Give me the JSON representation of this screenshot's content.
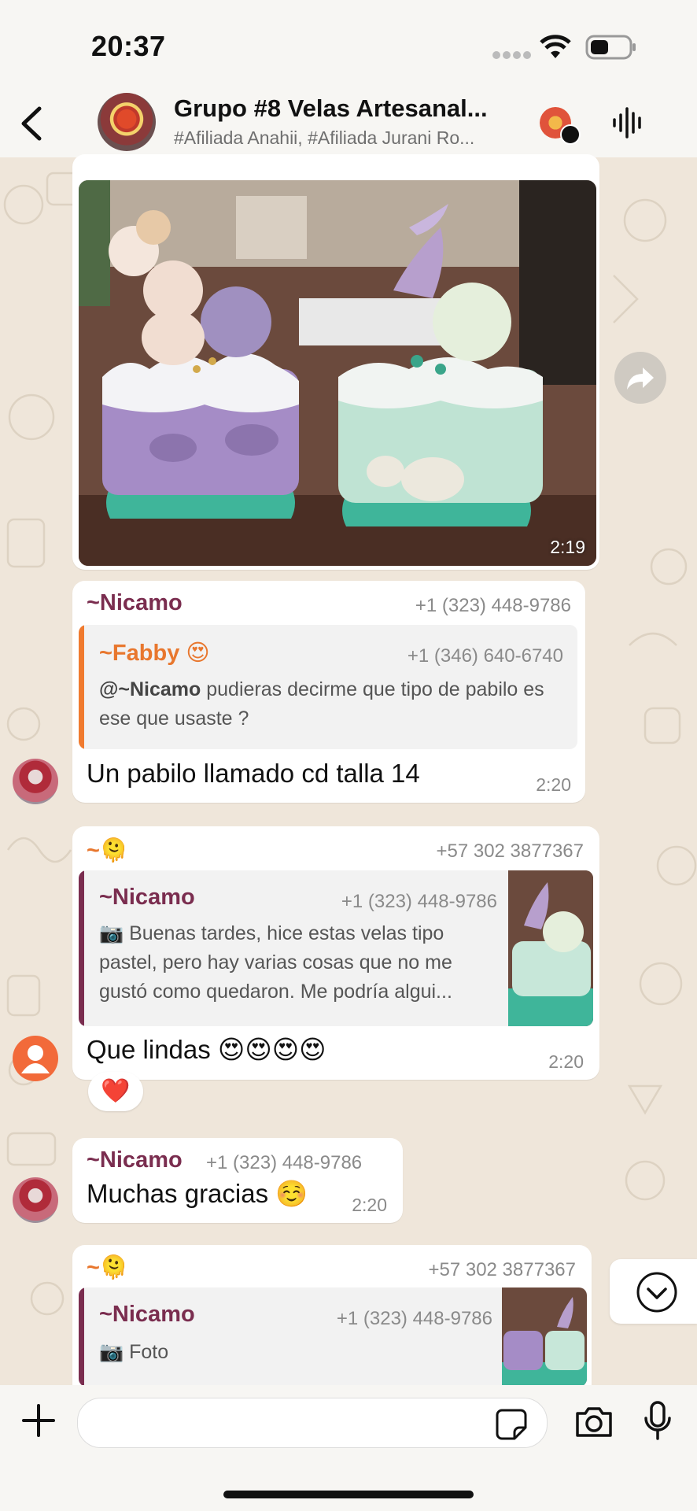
{
  "status_bar": {
    "time": "20:37"
  },
  "header": {
    "title": "Grupo #8 Velas Artesanal...",
    "subtitle": "#Afiliada Anahii, #Afiliada Jurani Ro..."
  },
  "messages": {
    "photo_time": "2:19",
    "m1": {
      "sender": "~Nicamo",
      "phone": "+1 (323) 448-9786",
      "quote_name": "~Fabby 😍",
      "quote_phone": "+1 (346) 640-6740",
      "quote_mention": "@~Nicamo",
      "quote_text": " pudieras decirme que tipo de pabilo es ese que usaste ?",
      "text": "Un pabilo llamado cd talla 14",
      "time": "2:20"
    },
    "m2": {
      "sender": "~🫠",
      "phone": "+57 302 3877367",
      "quote_name": "~Nicamo",
      "quote_phone": "+1 (323) 448-9786",
      "quote_text": "📷 Buenas tardes, hice estas velas tipo pastel, pero hay varias cosas que no me gustó como quedaron. Me podría algui...",
      "text": "Que lindas 😍😍😍😍",
      "time": "2:20",
      "reaction": "❤️"
    },
    "m3": {
      "sender": "~Nicamo",
      "phone": "+1 (323) 448-9786",
      "text": "Muchas gracias ☺️",
      "time": "2:20"
    },
    "m4": {
      "sender": "~🫠",
      "phone": "+57 302 3877367",
      "quote_name": "~Nicamo",
      "quote_phone": "+1 (323) 448-9786",
      "quote_text": "📷 Foto"
    }
  },
  "colors": {
    "nicamo": "#7a2d4f",
    "fabby": "#e8772e",
    "orange_bar": "#f07a2e",
    "maroon_bar": "#7a2d4f"
  },
  "input": {
    "placeholder": ""
  }
}
